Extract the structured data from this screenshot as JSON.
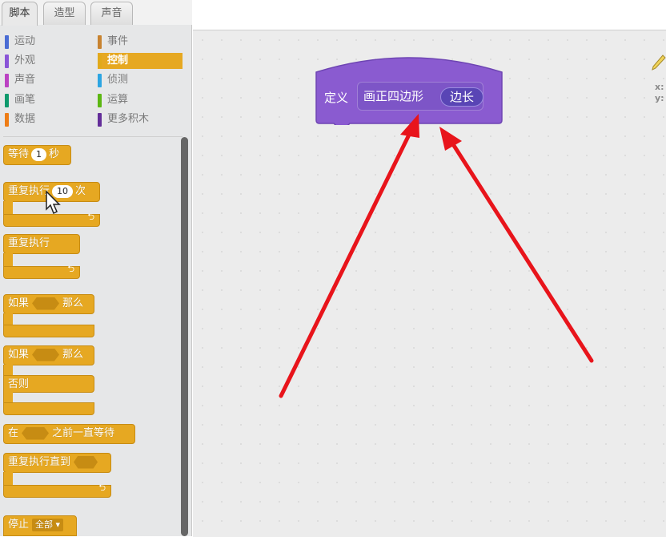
{
  "tabs": [
    "脚本",
    "造型",
    "声音"
  ],
  "categories": [
    {
      "label": "运动",
      "color": "#4a6cd4"
    },
    {
      "label": "事件",
      "color": "#c88330"
    },
    {
      "label": "外观",
      "color": "#8a55d7"
    },
    {
      "label": "控制",
      "color": "#e1a91a"
    },
    {
      "label": "声音",
      "color": "#bb42c3"
    },
    {
      "label": "侦测",
      "color": "#2ca5e2"
    },
    {
      "label": "画笔",
      "color": "#0e9a6c"
    },
    {
      "label": "运算",
      "color": "#5cb712"
    },
    {
      "label": "数据",
      "color": "#ee7d16"
    },
    {
      "label": "更多积木",
      "color": "#632d99"
    }
  ],
  "selected_category": "控制",
  "blocks": {
    "wait": {
      "label": "等待",
      "value": "1",
      "unit": "秒"
    },
    "repeat": {
      "label": "重复执行",
      "value": "10",
      "unit": "次"
    },
    "forever": {
      "label": "重复执行"
    },
    "if_then": {
      "if": "如果",
      "then": "那么"
    },
    "if_else": {
      "if": "如果",
      "then": "那么",
      "else": "否则"
    },
    "wait_until": {
      "prefix": "在",
      "suffix": "之前一直等待"
    },
    "repeat_until": {
      "label": "重复执行直到"
    },
    "stop": {
      "label": "停止",
      "option": "全部"
    }
  },
  "define_block": {
    "keyword": "定义",
    "name": "画正四边形",
    "param": "边长"
  },
  "sprite_info": {
    "x": "x:",
    "y": "y:"
  },
  "colors": {
    "control": "#e6a822",
    "define": "#8a5bd0",
    "annotation": "#e8141b"
  }
}
